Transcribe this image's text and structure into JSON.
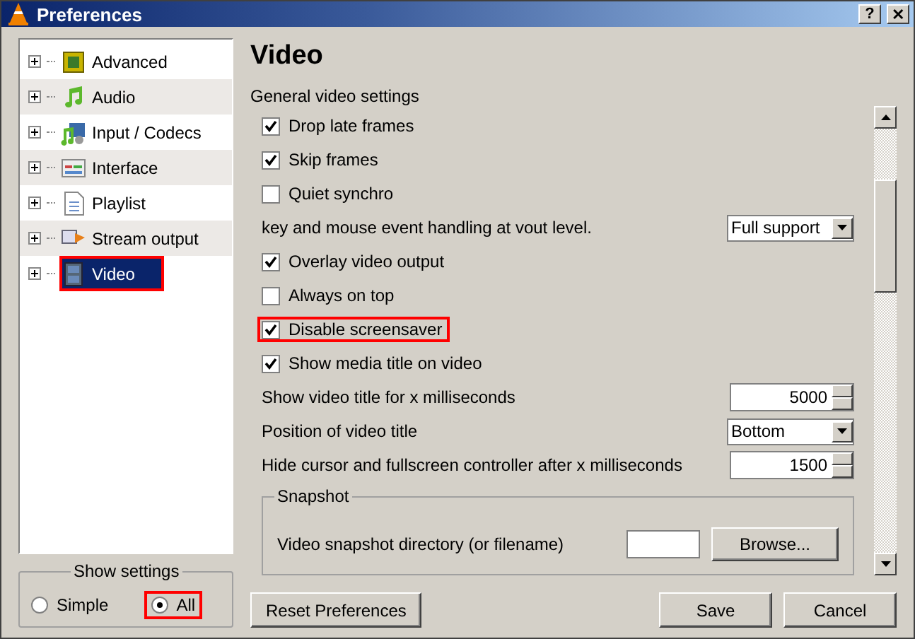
{
  "window": {
    "title": "Preferences",
    "buttons": [
      "?",
      "✕"
    ]
  },
  "tree": [
    {
      "label": "Advanced",
      "selected": false,
      "highlighted": false
    },
    {
      "label": "Audio",
      "selected": false,
      "highlighted": false
    },
    {
      "label": "Input / Codecs",
      "selected": false,
      "highlighted": false
    },
    {
      "label": "Interface",
      "selected": false,
      "highlighted": false
    },
    {
      "label": "Playlist",
      "selected": false,
      "highlighted": false
    },
    {
      "label": "Stream output",
      "selected": false,
      "highlighted": false
    },
    {
      "label": "Video",
      "selected": true,
      "highlighted": true
    }
  ],
  "show_settings": {
    "title": "Show settings",
    "options": [
      {
        "label": "Simple",
        "selected": false,
        "highlighted": false
      },
      {
        "label": "All",
        "selected": true,
        "highlighted": true
      }
    ]
  },
  "panel": {
    "title": "Video",
    "section": "General video settings",
    "settings": [
      {
        "kind": "checkbox",
        "label": "Drop late frames",
        "checked": true,
        "highlighted": false
      },
      {
        "kind": "checkbox",
        "label": "Skip frames",
        "checked": true,
        "highlighted": false
      },
      {
        "kind": "checkbox",
        "label": "Quiet synchro",
        "checked": false,
        "highlighted": false
      },
      {
        "kind": "select",
        "label": "key and mouse event handling at vout level.",
        "value": "Full support"
      },
      {
        "kind": "checkbox",
        "label": "Overlay video output",
        "checked": true,
        "highlighted": false
      },
      {
        "kind": "checkbox",
        "label": "Always on top",
        "checked": false,
        "highlighted": false
      },
      {
        "kind": "checkbox",
        "label": "Disable screensaver",
        "checked": true,
        "highlighted": true
      },
      {
        "kind": "checkbox",
        "label": "Show media title on video",
        "checked": true,
        "highlighted": false
      },
      {
        "kind": "spin",
        "label": "Show video title for x milliseconds",
        "value": "5000"
      },
      {
        "kind": "select",
        "label": "Position of video title",
        "value": "Bottom"
      },
      {
        "kind": "spin",
        "label": "Hide cursor and fullscreen controller after x milliseconds",
        "value": "1500"
      },
      {
        "kind": "group",
        "title": "Snapshot",
        "label": "Video snapshot directory (or filename)",
        "button": "Browse..."
      }
    ]
  },
  "buttons": {
    "reset": "Reset Preferences",
    "save": "Save",
    "cancel": "Cancel"
  }
}
